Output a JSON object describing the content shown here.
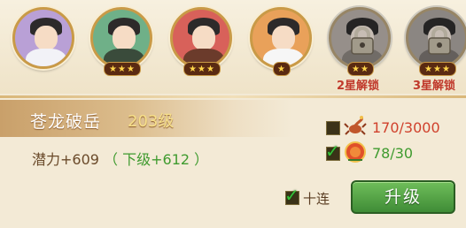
{
  "heroes": [
    {
      "name": "hero-1",
      "stars": "",
      "bg": "#b9a0d6",
      "locked": false
    },
    {
      "name": "hero-2",
      "stars": "★★★",
      "bg": "#6fb088",
      "locked": false
    },
    {
      "name": "hero-3",
      "stars": "★★★",
      "bg": "#d8615a",
      "locked": false
    },
    {
      "name": "hero-4",
      "stars": "★",
      "bg": "#e9a15a",
      "locked": false
    },
    {
      "name": "hero-5",
      "stars": "★★",
      "bg": "#b8a79a",
      "locked": true,
      "unlock_text": "2星解锁"
    },
    {
      "name": "hero-6",
      "stars": "★★★",
      "bg": "#a99c92",
      "locked": true,
      "unlock_text": "3星解锁"
    }
  ],
  "skill": {
    "name": "苍龙破岳",
    "level": "203级"
  },
  "potential": {
    "text": "潜力+609",
    "next": "（ 下级+612 ）"
  },
  "resources": [
    {
      "icon": "scorpion-icon",
      "text": "170/3000",
      "color": "#d0412c",
      "checked": false
    },
    {
      "icon": "drum-icon",
      "text": "78/30",
      "color": "#3f9b2f",
      "checked": true
    }
  ],
  "ten_times": {
    "label": "十连",
    "checked": true
  },
  "upgrade_button": {
    "label": "升级"
  }
}
